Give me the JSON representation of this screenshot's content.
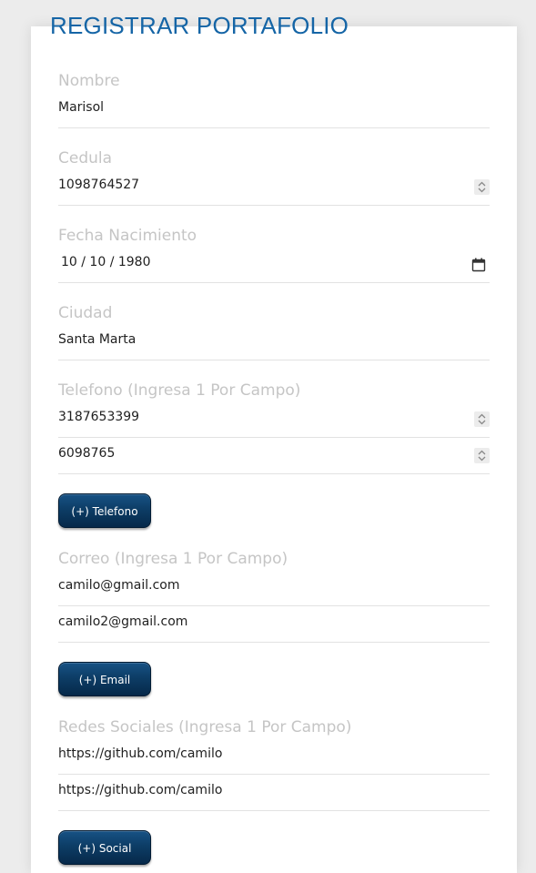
{
  "form": {
    "title": "REGISTRAR PORTAFOLIO",
    "nombre": {
      "label": "Nombre",
      "value": "Marisol"
    },
    "cedula": {
      "label": "Cedula",
      "value": "1098764527"
    },
    "fecha": {
      "label": "Fecha Nacimiento",
      "value": "10 / 10 / 1980"
    },
    "ciudad": {
      "label": "Ciudad",
      "value": "Santa Marta"
    },
    "telefono": {
      "label": "Telefono (Ingresa 1 Por Campo)",
      "values": [
        "3187653399",
        "6098765"
      ],
      "add_button": "(+) Telefono"
    },
    "correo": {
      "label": "Correo (Ingresa 1 Por Campo)",
      "values": [
        "camilo@gmail.com",
        "camilo2@gmail.com"
      ],
      "add_button": "(+) Email"
    },
    "redes": {
      "label": "Redes Sociales (Ingresa 1 Por Campo)",
      "values": [
        "https://github.com/camilo",
        "https://github.com/camilo"
      ],
      "add_button": "(+) Social"
    }
  },
  "colors": {
    "title": "#1565a6",
    "label": "#c5c5c5",
    "button": "#0d3d66",
    "background": "#ececec"
  },
  "icons": {
    "spinner": "spinner-arrows-icon",
    "date": "calendar-icon"
  }
}
